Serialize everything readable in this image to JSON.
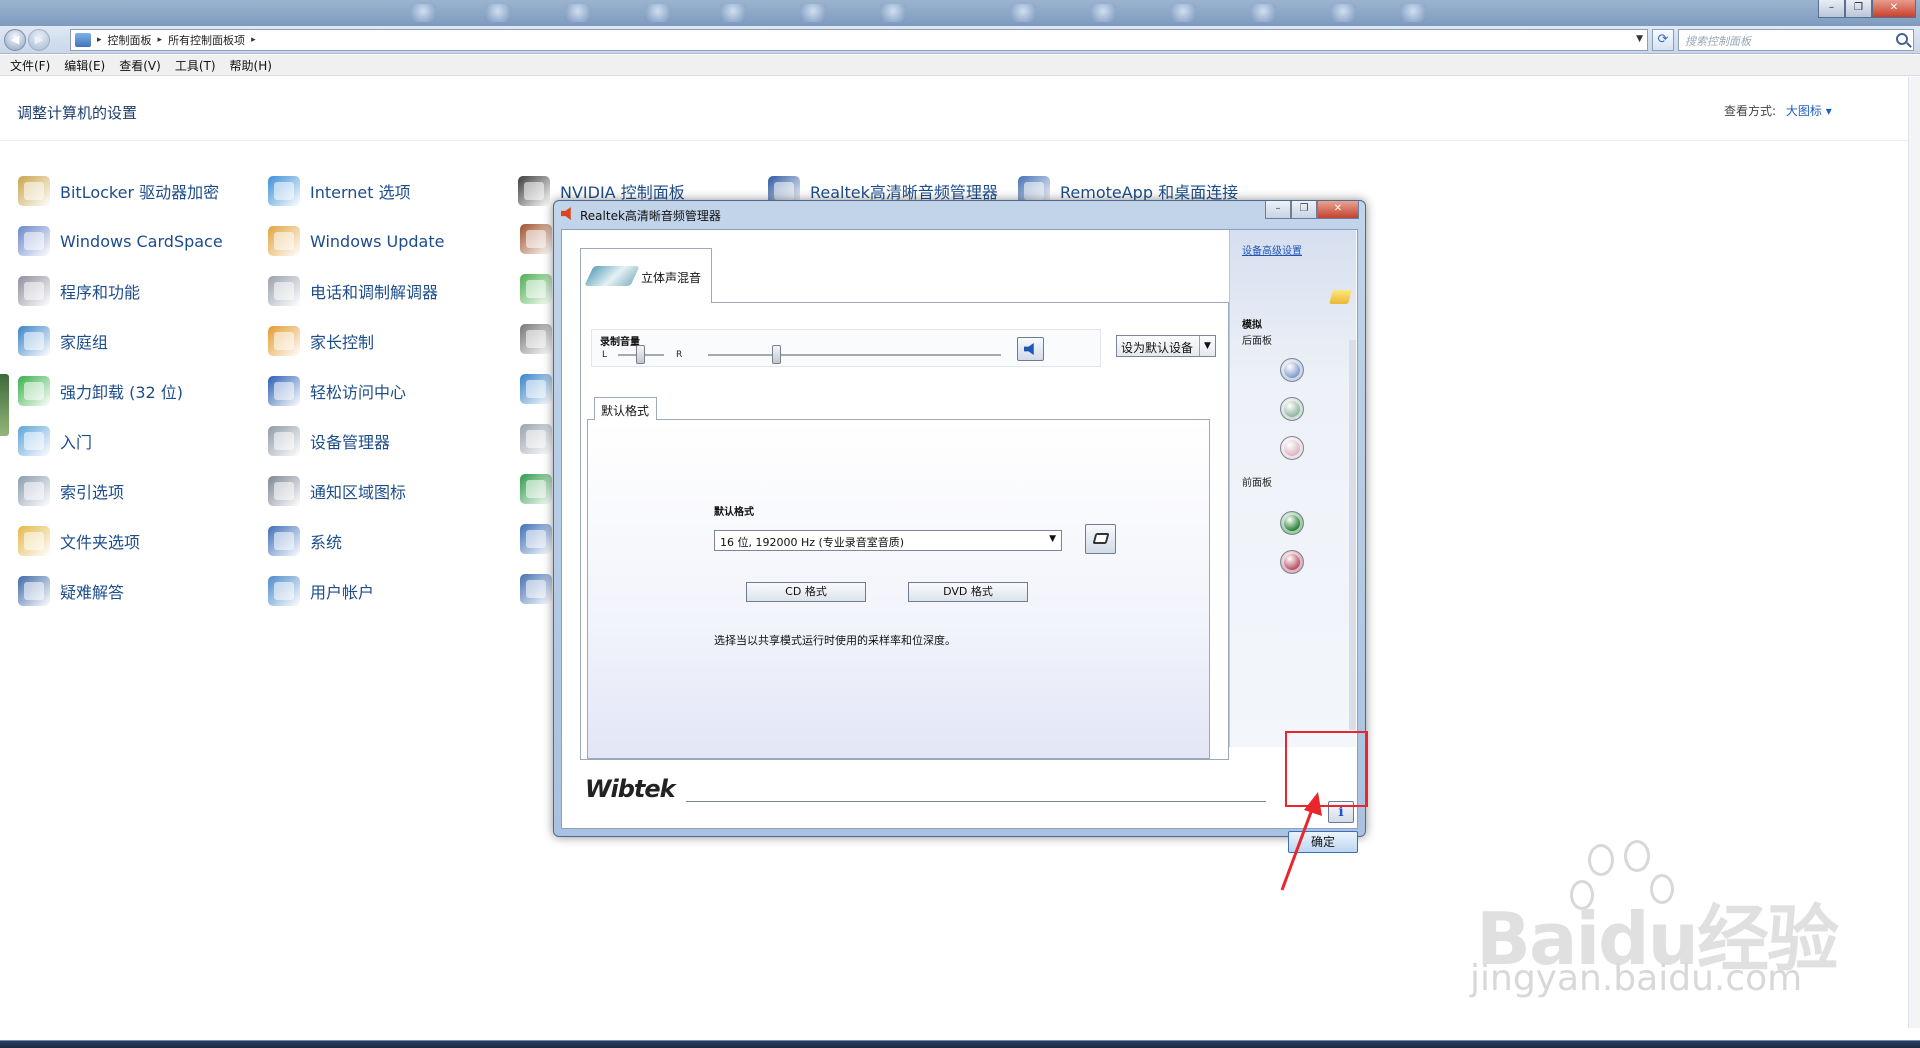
{
  "window": {
    "minimize_glyph": "–",
    "maximize_glyph": "❐",
    "close_glyph": "✕"
  },
  "address": {
    "crumbs": [
      "控制面板",
      "所有控制面板项"
    ],
    "separator": "▸",
    "search_placeholder": "搜索控制面板"
  },
  "menubar": [
    "文件(F)",
    "编辑(E)",
    "查看(V)",
    "工具(T)",
    "帮助(H)"
  ],
  "page": {
    "title": "调整计算机的设置",
    "view_by_label": "查看方式:",
    "view_by_value": "大图标 ▾"
  },
  "control_panel_items": [
    {
      "label": "BitLocker 驱动器加密",
      "icon": "bitlocker-icon",
      "color": "#c9a44b"
    },
    {
      "label": "Windows CardSpace",
      "icon": "cardspace-icon",
      "color": "#6a86c9"
    },
    {
      "label": "程序和功能",
      "icon": "programs-icon",
      "color": "#8f8f9f"
    },
    {
      "label": "家庭组",
      "icon": "homegroup-icon",
      "color": "#3a83c8"
    },
    {
      "label": "强力卸载 (32 位)",
      "icon": "uninstall-icon",
      "color": "#37b04a"
    },
    {
      "label": "入门",
      "icon": "getting-started-icon",
      "color": "#5ca3d9"
    },
    {
      "label": "索引选项",
      "icon": "indexing-icon",
      "color": "#8a9bb0"
    },
    {
      "label": "文件夹选项",
      "icon": "folder-options-icon",
      "color": "#e3b84a"
    },
    {
      "label": "疑难解答",
      "icon": "troubleshooting-icon",
      "color": "#3e6aa8"
    },
    {
      "label": "Internet 选项",
      "icon": "internet-options-icon",
      "color": "#3b8fd6"
    },
    {
      "label": "Windows Update",
      "icon": "windows-update-icon",
      "color": "#e2a33d"
    },
    {
      "label": "电话和调制解调器",
      "icon": "phone-modem-icon",
      "color": "#9aa2ad"
    },
    {
      "label": "家长控制",
      "icon": "parental-controls-icon",
      "color": "#e39b2e"
    },
    {
      "label": "轻松访问中心",
      "icon": "ease-of-access-icon",
      "color": "#2a5fb5"
    },
    {
      "label": "设备管理器",
      "icon": "device-manager-icon",
      "color": "#8f9aa8"
    },
    {
      "label": "通知区域图标",
      "icon": "notification-icons-icon",
      "color": "#7d8796"
    },
    {
      "label": "系统",
      "icon": "system-icon",
      "color": "#3d6fb8"
    },
    {
      "label": "用户帐户",
      "icon": "user-accounts-icon",
      "color": "#4c8acb"
    },
    {
      "label": "NVIDIA 控制面板",
      "icon": "nvidia-icon",
      "color": "#3d3d3d"
    },
    {
      "label": "Realtek高清晰音频管理器",
      "icon": "realtek-icon",
      "color": "#2d5aa0"
    },
    {
      "label": "RemoteApp 和桌面连接",
      "icon": "remoteapp-icon",
      "color": "#4670b3"
    }
  ],
  "dialog": {
    "title": "Realtek高清晰音频管理器",
    "device_tab": "立体声混音",
    "record_volume_label": "录制音量",
    "balance_left": "L",
    "balance_right": "R",
    "default_device_button": "设为默认设备",
    "format_tab": "默认格式",
    "format_label": "默认格式",
    "format_value": "16 位, 192000 Hz (专业录音室音质)",
    "cd_button": "CD 格式",
    "dvd_button": "DVD 格式",
    "format_description": "选择当以共享模式运行时使用的采样率和位深度。",
    "advanced_link": "设备高级设置",
    "analog_label": "模拟",
    "rear_panel_label": "后面板",
    "front_panel_label": "前面板",
    "brand": "Wibtek",
    "info_button": "i",
    "ok_button": "确定",
    "jacks": [
      {
        "panel": "rear",
        "color": "#7d98c9"
      },
      {
        "panel": "rear",
        "color": "#8db29b"
      },
      {
        "panel": "rear",
        "color": "#d9b3c3"
      },
      {
        "panel": "front",
        "color": "#1c7a2a"
      },
      {
        "panel": "front",
        "color": "#b3475a"
      }
    ]
  },
  "watermark": {
    "logo": "Baidu经验",
    "url": "jingyan.baidu.com"
  },
  "colors": {
    "annotation_red": "#e8262b",
    "link_blue": "#1d4d8b"
  }
}
